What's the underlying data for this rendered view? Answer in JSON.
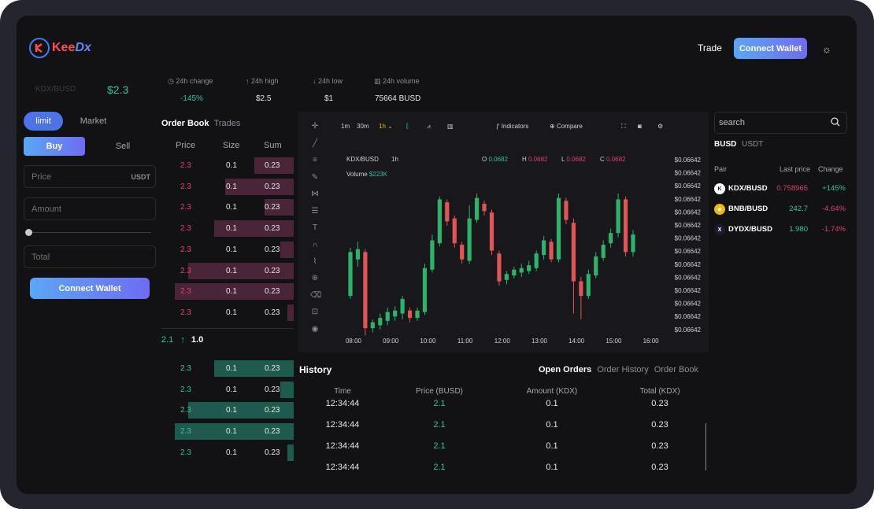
{
  "brand": {
    "name_left": "Kee",
    "name_right": "Dx"
  },
  "nav": {
    "trade": "Trade",
    "connect": "Connect Wallet"
  },
  "ticker": {
    "pair": "KDX/BUSD",
    "price": "$2.3",
    "stats": [
      {
        "icon": "clock-icon",
        "label": "24h change",
        "value": "-145%"
      },
      {
        "icon": "arrow-up-icon",
        "label": "24h high",
        "value": "$2.5"
      },
      {
        "icon": "arrow-down-icon",
        "label": "24h low",
        "value": "$1"
      },
      {
        "icon": "bar-chart-icon",
        "label": "24h volume",
        "value": "75664 BUSD"
      }
    ]
  },
  "order_form": {
    "tabs": [
      "limit",
      "Market"
    ],
    "sides": [
      "Buy",
      "Sell"
    ],
    "price_placeholder": "Price",
    "price_unit": "USDT",
    "amount_placeholder": "Amount",
    "total_placeholder": "Total",
    "connect": "Connect Wallet"
  },
  "orderbook": {
    "tabs": [
      "Order Book",
      "Trades"
    ],
    "headers": [
      "Price",
      "Size",
      "Sum"
    ],
    "asks": [
      {
        "price": "2.3",
        "size": "0.1",
        "sum": "0.23",
        "depth": 0.3
      },
      {
        "price": "2.3",
        "size": "0.1",
        "sum": "0.23",
        "depth": 0.52
      },
      {
        "price": "2.3",
        "size": "0.1",
        "sum": "0.23",
        "depth": 0.22
      },
      {
        "price": "2.3",
        "size": "0.1",
        "sum": "0.23",
        "depth": 0.6
      },
      {
        "price": "2.3",
        "size": "0.1",
        "sum": "0.23",
        "depth": 0.1
      },
      {
        "price": "2.3",
        "size": "0.1",
        "sum": "0.23",
        "depth": 0.8
      },
      {
        "price": "2.3",
        "size": "0.1",
        "sum": "0.23",
        "depth": 0.9
      },
      {
        "price": "2.3",
        "size": "0.1",
        "sum": "0.23",
        "depth": 0.05
      }
    ],
    "mid": {
      "price": "2.1",
      "arrow": "↑",
      "size": "1.0"
    },
    "bids": [
      {
        "price": "2.3",
        "size": "0.1",
        "sum": "0.23",
        "depth": 0.6
      },
      {
        "price": "2.3",
        "size": "0.1",
        "sum": "0.23",
        "depth": 0.1
      },
      {
        "price": "2.3",
        "size": "0.1",
        "sum": "0.23",
        "depth": 0.8
      },
      {
        "price": "2.3",
        "size": "0.1",
        "sum": "0.23",
        "depth": 0.9
      },
      {
        "price": "2.3",
        "size": "0.1",
        "sum": "0.23",
        "depth": 0.05
      }
    ]
  },
  "chart_toolbar": {
    "timeframes": [
      "1m",
      "30m",
      "1h"
    ],
    "indicators": "Indicators",
    "compare": "Compare"
  },
  "chart_data": {
    "type": "candlestick",
    "symbol": "KDX/BUSD",
    "interval": "1h",
    "ohlc": {
      "o": "0.0682",
      "h": "0.0682",
      "l": "0.0682",
      "c": "0.0682"
    },
    "volume_label": "Volume",
    "volume_value": "$223K",
    "x_ticks": [
      "08:00",
      "09:00",
      "10:00",
      "11:00",
      "12:00",
      "13:00",
      "14:00",
      "15:00",
      "16:00"
    ],
    "y_ticks": [
      "$0.06642",
      "$0.06642",
      "$0.06642",
      "$0.06642",
      "$0.06642",
      "$0.06642",
      "$0.06642",
      "$0.06642",
      "$0.06642",
      "$0.06642",
      "$0.06642",
      "$0.06642",
      "$0.06642",
      "$0.06642"
    ],
    "colors": {
      "up": "#2fb36a",
      "down": "#e05555"
    },
    "candles": [
      {
        "o": 0.3,
        "c": 0.6,
        "h": 0.63,
        "l": 0.28
      },
      {
        "o": 0.55,
        "c": 0.62,
        "h": 0.67,
        "l": 0.5
      },
      {
        "o": 0.6,
        "c": 0.08,
        "h": 0.62,
        "l": 0.03
      },
      {
        "o": 0.08,
        "c": 0.12,
        "h": 0.14,
        "l": 0.05
      },
      {
        "o": 0.1,
        "c": 0.15,
        "h": 0.18,
        "l": 0.07
      },
      {
        "o": 0.13,
        "c": 0.19,
        "h": 0.22,
        "l": 0.1
      },
      {
        "o": 0.16,
        "c": 0.2,
        "h": 0.23,
        "l": 0.13
      },
      {
        "o": 0.18,
        "c": 0.28,
        "h": 0.3,
        "l": 0.14
      },
      {
        "o": 0.2,
        "c": 0.15,
        "h": 0.22,
        "l": 0.12
      },
      {
        "o": 0.15,
        "c": 0.2,
        "h": 0.22,
        "l": 0.13
      },
      {
        "o": 0.19,
        "c": 0.49,
        "h": 0.52,
        "l": 0.17
      },
      {
        "o": 0.48,
        "c": 0.68,
        "h": 0.72,
        "l": 0.46
      },
      {
        "o": 0.66,
        "c": 0.96,
        "h": 0.98,
        "l": 0.64
      },
      {
        "o": 0.94,
        "c": 0.81,
        "h": 0.96,
        "l": 0.78
      },
      {
        "o": 0.83,
        "c": 0.66,
        "h": 0.85,
        "l": 0.63
      },
      {
        "o": 0.65,
        "c": 0.55,
        "h": 0.67,
        "l": 0.52
      },
      {
        "o": 0.54,
        "c": 0.83,
        "h": 0.92,
        "l": 0.52
      },
      {
        "o": 0.82,
        "c": 0.97,
        "h": 1.0,
        "l": 0.8
      },
      {
        "o": 0.93,
        "c": 0.88,
        "h": 0.95,
        "l": 0.85
      },
      {
        "o": 0.87,
        "c": 0.61,
        "h": 0.89,
        "l": 0.58
      },
      {
        "o": 0.59,
        "c": 0.4,
        "h": 0.61,
        "l": 0.37
      },
      {
        "o": 0.41,
        "c": 0.45,
        "h": 0.47,
        "l": 0.38
      },
      {
        "o": 0.44,
        "c": 0.48,
        "h": 0.5,
        "l": 0.42
      },
      {
        "o": 0.46,
        "c": 0.49,
        "h": 0.52,
        "l": 0.43
      },
      {
        "o": 0.47,
        "c": 0.51,
        "h": 0.54,
        "l": 0.45
      },
      {
        "o": 0.49,
        "c": 0.59,
        "h": 0.61,
        "l": 0.47
      },
      {
        "o": 0.58,
        "c": 0.68,
        "h": 0.71,
        "l": 0.55
      },
      {
        "o": 0.67,
        "c": 0.55,
        "h": 0.69,
        "l": 0.53
      },
      {
        "o": 0.55,
        "c": 0.97,
        "h": 1.0,
        "l": 0.53
      },
      {
        "o": 0.95,
        "c": 0.82,
        "h": 0.97,
        "l": 0.79
      },
      {
        "o": 0.8,
        "c": 0.4,
        "h": 0.83,
        "l": 0.18
      },
      {
        "o": 0.4,
        "c": 0.3,
        "h": 0.43,
        "l": 0.14
      },
      {
        "o": 0.3,
        "c": 0.45,
        "h": 0.48,
        "l": 0.28
      },
      {
        "o": 0.44,
        "c": 0.57,
        "h": 0.6,
        "l": 0.42
      },
      {
        "o": 0.56,
        "c": 0.65,
        "h": 0.68,
        "l": 0.54
      },
      {
        "o": 0.66,
        "c": 0.73,
        "h": 0.76,
        "l": 0.63
      },
      {
        "o": 0.73,
        "c": 0.96,
        "h": 1.0,
        "l": 0.7
      },
      {
        "o": 0.96,
        "c": 0.6,
        "h": 0.98,
        "l": 0.57
      },
      {
        "o": 0.6,
        "c": 0.72,
        "h": 0.75,
        "l": 0.57
      }
    ]
  },
  "history": {
    "title": "History",
    "tabs": [
      "Open Orders",
      "Order History",
      "Order Book"
    ],
    "columns": [
      "Time",
      "Price (BUSD)",
      "Amount (KDX)",
      "Total (KDX)"
    ],
    "rows": [
      [
        "12:34:44",
        "2.1",
        "0.1",
        "0.23"
      ],
      [
        "12:34:44",
        "2.1",
        "0.1",
        "0.23"
      ],
      [
        "12:34:44",
        "2.1",
        "0.1",
        "0.23"
      ],
      [
        "12:34:44",
        "2.1",
        "0.1",
        "0.23"
      ]
    ]
  },
  "markets": {
    "search_placeholder": "search",
    "tabs": [
      "BUSD",
      "USDT"
    ],
    "headers": [
      "Pair",
      "Last price",
      "Change"
    ],
    "rows": [
      {
        "icon": "kdx-coin-icon",
        "glyph": "K",
        "icon_bg": "#ffffff",
        "icon_fg": "#1a1a2a",
        "pair": "KDX/BUSD",
        "price": "0.758965",
        "change": "+145%",
        "price_color": "#e0406a",
        "change_color": "#2fc2a0"
      },
      {
        "icon": "bnb-coin-icon",
        "glyph": "◆",
        "icon_bg": "#f0b90b",
        "icon_fg": "#ffffff",
        "pair": "BNB/BUSD",
        "price": "242.7",
        "change": "-4.64%",
        "price_color": "#2fc2a0",
        "change_color": "#e0406a"
      },
      {
        "icon": "dydx-coin-icon",
        "glyph": "X",
        "icon_bg": "#1c1c2e",
        "icon_fg": "#ffffff",
        "pair": "DYDX/BUSD",
        "price": "1.980",
        "change": "-1.74%",
        "price_color": "#2fc2a0",
        "change_color": "#e0406a"
      }
    ]
  }
}
